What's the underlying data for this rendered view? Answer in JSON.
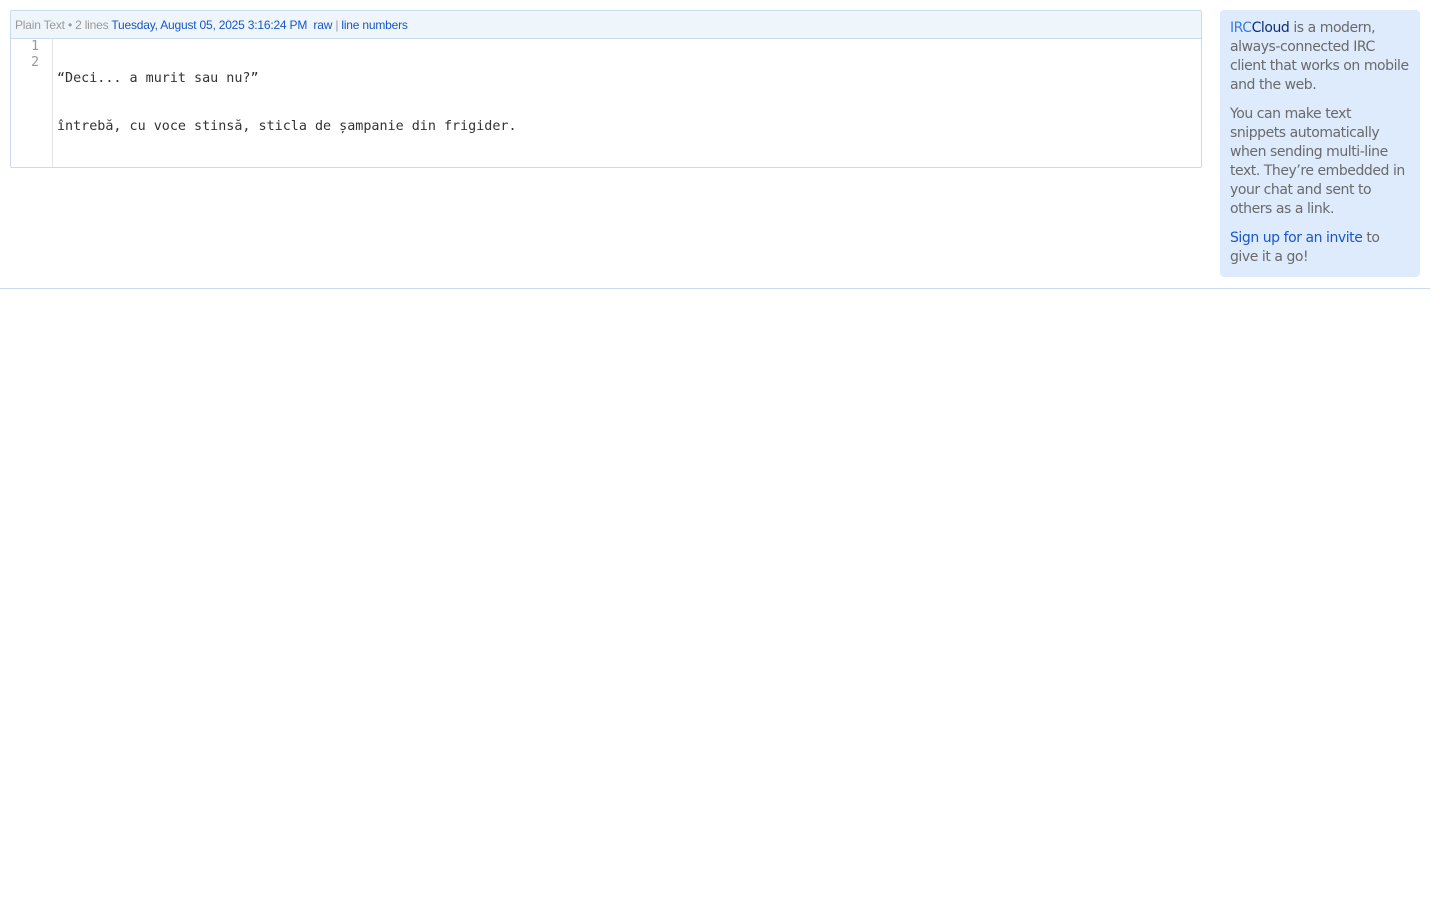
{
  "snippet": {
    "language": "Plain Text",
    "bullet": "•",
    "line_count": "2 lines",
    "timestamp": "Tuesday, August 05, 2025 3:16:24 PM",
    "raw_label": "raw",
    "separator": "|",
    "line_numbers_label": "line numbers",
    "gutter": [
      "1",
      "2"
    ],
    "lines": [
      "“Deci... a murit sau nu?”",
      "întrebă, cu voce stinsă, sticla de șampanie din frigider."
    ]
  },
  "promo": {
    "brand_irc": "IRC",
    "brand_cloud": "Cloud",
    "intro_rest": " is a modern, always-connected IRC client that works on mobile and the web.",
    "paragraph_2": "You can make text snippets automatically when sending multi-line text. They’re embedded in your chat and sent to others as a link.",
    "signup_link": "Sign up for an invite",
    "signup_rest": " to give it a go!"
  },
  "colors": {
    "link": "#1a56c8",
    "promo_bg": "#deebfd",
    "header_bg": "#eef5fb",
    "border": "#c9dcef"
  }
}
